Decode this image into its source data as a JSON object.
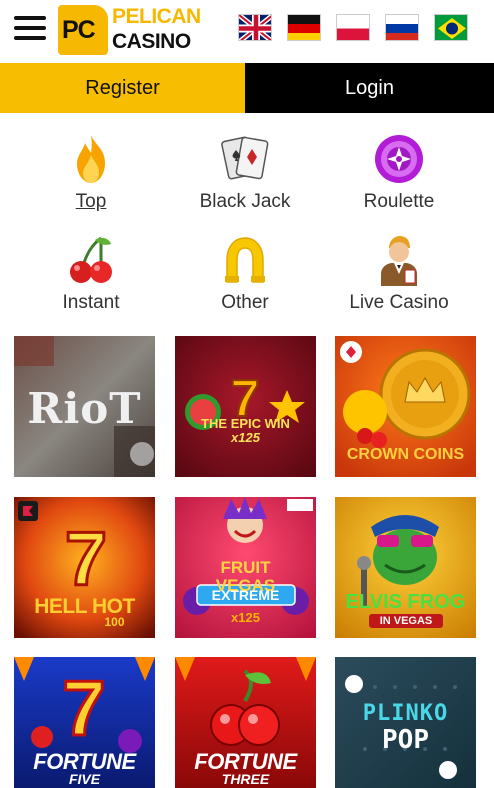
{
  "header": {
    "logo": {
      "badge": "PC",
      "line1": "PELICAN",
      "line2": "CASINO"
    },
    "menu_icon": "hamburger-icon",
    "languages": [
      "flag-uk-icon",
      "flag-de-icon",
      "flag-pl-icon",
      "flag-ru-icon",
      "flag-br-icon"
    ]
  },
  "auth": {
    "register_label": "Register",
    "login_label": "Login"
  },
  "categories": [
    {
      "label": "Top",
      "icon": "flame-icon",
      "active": true
    },
    {
      "label": "Black Jack",
      "icon": "cards-icon",
      "active": false
    },
    {
      "label": "Roulette",
      "icon": "roulette-icon",
      "active": false
    },
    {
      "label": "Instant",
      "icon": "cherries-icon",
      "active": false
    },
    {
      "label": "Other",
      "icon": "horseshoe-icon",
      "active": false
    },
    {
      "label": "Live Casino",
      "icon": "dealer-icon",
      "active": false
    }
  ],
  "games": [
    {
      "title": "RioT"
    },
    {
      "title": "THE EPIC WIN",
      "subtitle": "x125"
    },
    {
      "title": "CROWN COINS"
    },
    {
      "title": "HELL HOT",
      "subtitle": "100"
    },
    {
      "title": "FRUIT VEGAS",
      "subtitle": "EXTREME",
      "badge": "x125"
    },
    {
      "title": "ELVIS FROG",
      "subtitle": "IN VEGAS"
    },
    {
      "title": "FORTUNE",
      "subtitle": "FIVE"
    },
    {
      "title": "FORTUNE",
      "subtitle": "THREE"
    },
    {
      "title": "PLINKO",
      "subtitle": "POP"
    }
  ],
  "colors": {
    "brand_yellow": "#f7bd00",
    "login_black": "#000000"
  }
}
